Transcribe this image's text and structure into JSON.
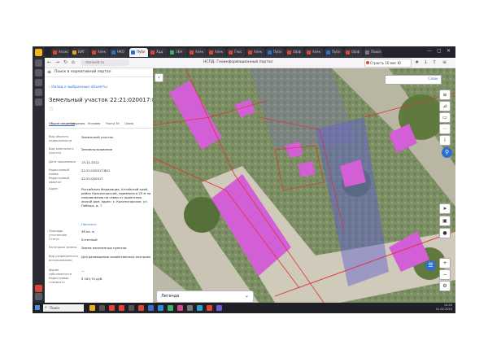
{
  "browser": {
    "tabs": [
      {
        "label": "Алакс",
        "color": "#e0433a"
      },
      {
        "label": "ВИГ",
        "color": "#e8a020"
      },
      {
        "label": "Алек",
        "color": "#e0433a"
      },
      {
        "label": "НКО",
        "color": "#2c6fd2"
      },
      {
        "label": "Публ",
        "color": "#2c6fd2"
      },
      {
        "label": "Хдд",
        "color": "#e0433a"
      },
      {
        "label": "ЗЕН",
        "color": "#3bb36a"
      },
      {
        "label": "Алек",
        "color": "#e0433a"
      },
      {
        "label": "Алек",
        "color": "#e0433a"
      },
      {
        "label": "Геос",
        "color": "#e0433a"
      },
      {
        "label": "Алек",
        "color": "#e0433a"
      },
      {
        "label": "Публ",
        "color": "#2c6fd2"
      },
      {
        "label": "Офф",
        "color": "#e0433a"
      },
      {
        "label": "Алек",
        "color": "#e0433a"
      },
      {
        "label": "Публ",
        "color": "#2c6fd2"
      },
      {
        "label": "Офф",
        "color": "#e0433a"
      },
      {
        "label": "Поиск",
        "color": "#7a7a85"
      }
    ],
    "url": "rosreestr.ru",
    "page_title": "НСПД: Геоинформационный портал",
    "right_button": "Страсть 10 мес Ю"
  },
  "panel": {
    "header": "Поиск в нормативной портал",
    "back_label": "Назад к выбранные объекты",
    "title": "Земельный участок 22:21:020017:801",
    "tabs": [
      "Общие сведения",
      "Сведения",
      "Условия",
      "Части ЗУ",
      "Связи"
    ],
    "rows": [
      {
        "label": "Вид объекта недвижимости",
        "value": "Земельный участок"
      },
      {
        "label": "Вид земельного участка",
        "value": "Землепользование"
      },
      {
        "label": "Дата присвоения",
        "value": "13.11.2012"
      },
      {
        "label": "Кадастровый номер",
        "value": "22:21:020017:801"
      },
      {
        "label": "Кадастровый квартал",
        "value": "22:21:020017"
      },
      {
        "label": "Адрес",
        "value": "Российская Федерация, Алтайский край, район Красногорский, примерно в 25 м по направлению на север от ориентира жилой дом, адрес: с. Красногорское, ул. Победы, д. 7"
      },
      {
        "label": "",
        "value": "Показать"
      },
      {
        "label": "Площадь уточненная",
        "value": "38 кв. м"
      },
      {
        "label": "Статус",
        "value": "Учтенный"
      },
      {
        "label": "Категория земель",
        "value": "Земли населенных пунктов"
      },
      {
        "label": "Вид разрешенного использования",
        "value": "Для размещения хозяйственных построек"
      },
      {
        "label": "Форма собственности",
        "value": "—"
      },
      {
        "label": "Кадастровая стоимость",
        "value": "5 163,74 руб."
      }
    ]
  },
  "map": {
    "legend_label": "Легенда",
    "search_label": "Слои",
    "tools": [
      "layers-icon",
      "ruler-icon",
      "print-icon",
      "share-icon",
      "info-icon"
    ],
    "building_color": "#d35fd6",
    "zone_color": "#5b5bd6",
    "boundary_color": "#e0303a"
  },
  "taskbar": {
    "search_placeholder": "Поиск",
    "time": "14:25",
    "date": "01.02.2024"
  }
}
